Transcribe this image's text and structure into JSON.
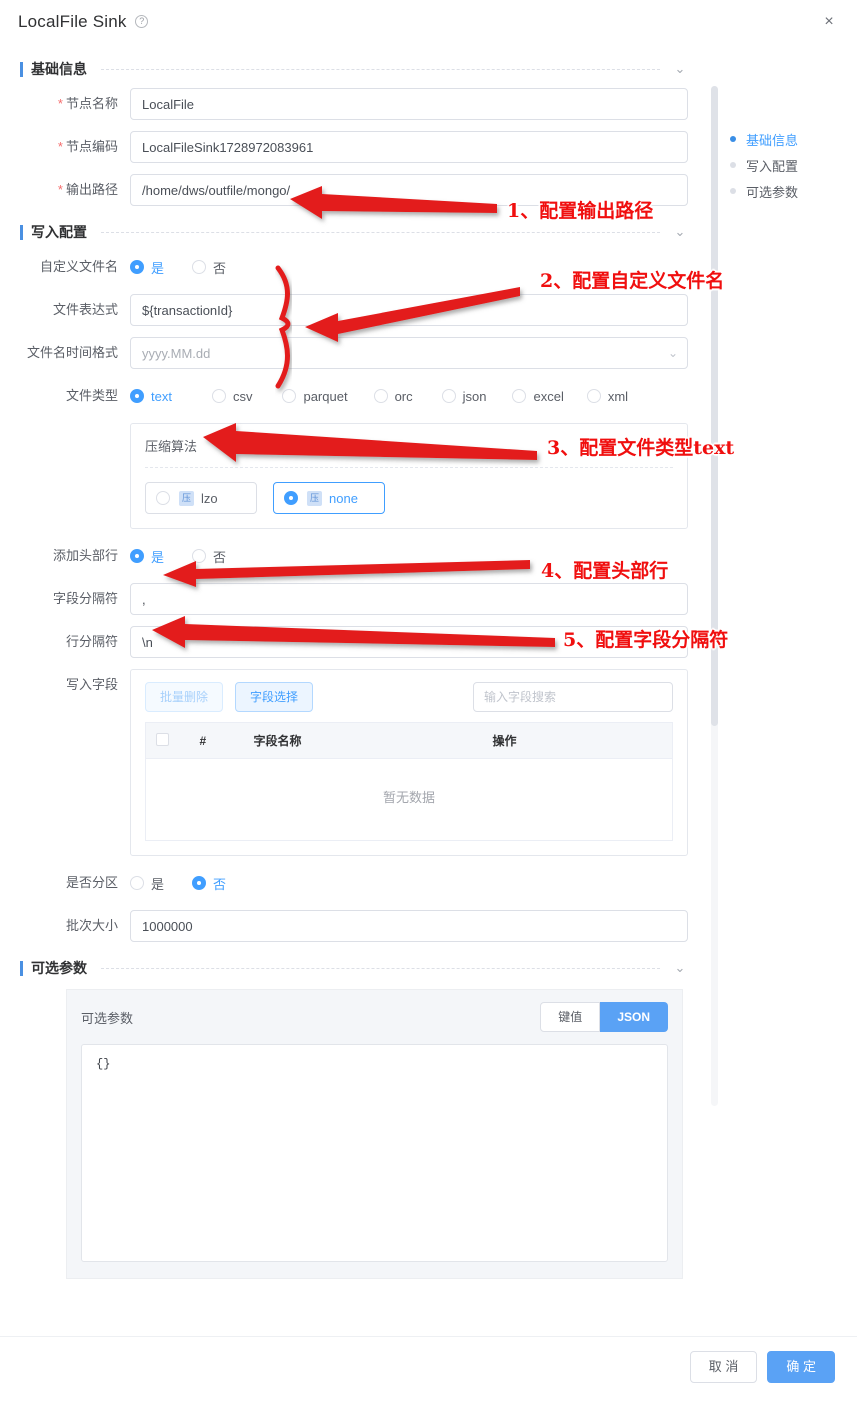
{
  "dialog": {
    "title": "LocalFile Sink",
    "help_icon": "question-circle-icon",
    "close_icon": "×"
  },
  "anchor_nav": [
    {
      "label": "基础信息",
      "active": true
    },
    {
      "label": "写入配置",
      "active": false
    },
    {
      "label": "可选参数",
      "active": false
    }
  ],
  "sections": {
    "basic": {
      "title": "基础信息",
      "caret": "⌄",
      "fields": {
        "node_name": {
          "label": "节点名称",
          "value": "LocalFile"
        },
        "node_code": {
          "label": "节点编码",
          "value": "LocalFileSink1728972083961"
        },
        "output_path": {
          "label": "输出路径",
          "value": "/home/dws/outfile/mongo/"
        }
      }
    },
    "write": {
      "title": "写入配置",
      "caret": "⌄",
      "custom_filename": {
        "label": "自定义文件名",
        "options": [
          {
            "label": "是",
            "selected": true
          },
          {
            "label": "否",
            "selected": false
          }
        ]
      },
      "file_expression": {
        "label": "文件表达式",
        "value": "${transactionId}"
      },
      "filename_time_format": {
        "label": "文件名时间格式",
        "value": "yyyy.MM.dd",
        "caret": "⌄"
      },
      "file_type": {
        "label": "文件类型",
        "options": [
          {
            "label": "text",
            "selected": true
          },
          {
            "label": "csv",
            "selected": false
          },
          {
            "label": "parquet",
            "selected": false
          },
          {
            "label": "orc",
            "selected": false
          },
          {
            "label": "json",
            "selected": false
          },
          {
            "label": "excel",
            "selected": false
          },
          {
            "label": "xml",
            "selected": false
          }
        ]
      },
      "compression": {
        "title": "压缩算法",
        "options": [
          {
            "label": "lzo",
            "selected": false
          },
          {
            "label": "none",
            "selected": true
          }
        ]
      },
      "header_row": {
        "label": "添加头部行",
        "options": [
          {
            "label": "是",
            "selected": true
          },
          {
            "label": "否",
            "selected": false
          }
        ]
      },
      "field_separator": {
        "label": "字段分隔符",
        "value": ","
      },
      "line_separator": {
        "label": "行分隔符",
        "value": "\\n"
      },
      "write_fields": {
        "label": "写入字段",
        "batch_delete_label": "批量删除",
        "field_select_label": "字段选择",
        "search_placeholder": "输入字段搜索",
        "columns": [
          "",
          "#",
          "字段名称",
          "操作"
        ],
        "rows": [],
        "empty_text": "暂无数据"
      },
      "partition": {
        "label": "是否分区",
        "options": [
          {
            "label": "是",
            "selected": false
          },
          {
            "label": "否",
            "selected": true
          }
        ]
      },
      "batch_size": {
        "label": "批次大小",
        "value": "1000000"
      }
    },
    "optional": {
      "title": "可选参数",
      "caret": "⌄",
      "card_title": "可选参数",
      "modes": [
        {
          "label": "键值",
          "active": false
        },
        {
          "label": "JSON",
          "active": true
        }
      ],
      "json_value": "{}"
    }
  },
  "footer": {
    "cancel_label": "取 消",
    "confirm_label": "确 定"
  },
  "annotations": [
    {
      "text": "1、配置输出路径"
    },
    {
      "text": "2、配置自定义文件名"
    },
    {
      "text": "3、配置文件类型text"
    },
    {
      "text": "4、配置头部行"
    },
    {
      "text": "5、配置字段分隔符"
    }
  ],
  "colors": {
    "primary": "#409eff",
    "annotation": "#f00f0f",
    "required": "#f56c6c"
  }
}
